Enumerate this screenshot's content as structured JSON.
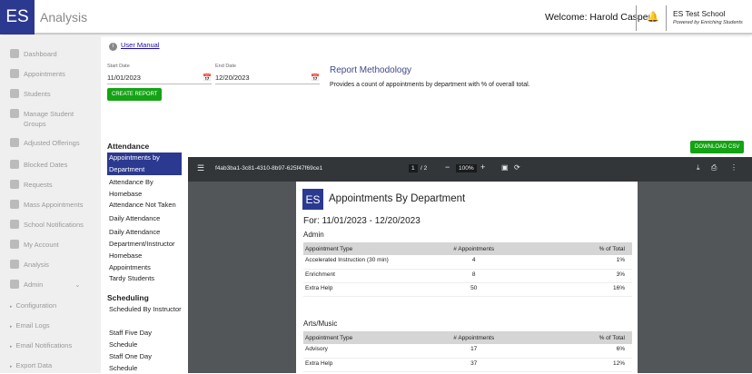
{
  "header": {
    "logo": "ES",
    "title": "Analysis",
    "welcome": "Welcome: Harold Casper",
    "school": "ES Test School",
    "powered": "Powered by Enriching Students"
  },
  "sidebar": {
    "items": [
      {
        "label": "Dashboard",
        "icon": "dashboard-icon"
      },
      {
        "label": "Appointments",
        "icon": "calendar-check-icon"
      },
      {
        "label": "Students",
        "icon": "graduation-cap-icon"
      },
      {
        "label": "Manage Student Groups",
        "icon": "group-icon"
      },
      {
        "label": "Adjusted Offerings",
        "icon": "laptop-icon"
      },
      {
        "label": "Blocked Dates",
        "icon": "calendar-x-icon"
      },
      {
        "label": "Requests",
        "icon": "request-icon"
      },
      {
        "label": "Mass Appointments",
        "icon": "calendar-icon"
      },
      {
        "label": "School Notifications",
        "icon": "bell-icon"
      },
      {
        "label": "My Account",
        "icon": "account-icon"
      },
      {
        "label": "Analysis",
        "icon": "pie-chart-icon"
      },
      {
        "label": "Admin",
        "icon": "gear-icon"
      }
    ],
    "subitems": [
      "Configuration",
      "Email Logs",
      "Email Notifications",
      "Export Data"
    ]
  },
  "form": {
    "user_manual": "User Manual",
    "start_label": "Start Date",
    "start_value": "11/01/2023",
    "end_label": "End Date",
    "end_value": "12/20/2023",
    "create": "CREATE REPORT",
    "method_title": "Report Methodology",
    "method_desc": "Provides a count of appointments by department with % of overall total.",
    "download": "DOWNLOAD CSV"
  },
  "reports": {
    "attendance_heading": "Attendance",
    "attendance": [
      "Appointments by Department",
      "Attendance By Homebase",
      "Attendance Not Taken",
      "Daily Attendance",
      "Daily Attendance Department/Instructor",
      "Homebase Appointments",
      "Tardy Students"
    ],
    "scheduling_heading": "Scheduling",
    "scheduling": [
      "Scheduled By Instructor",
      "Staff Five Day Schedule",
      "Staff One Day Schedule"
    ]
  },
  "viewer": {
    "filename": "f4ab3ba1-3c81-4310-8b97-625f47f69ce1",
    "page": "1",
    "pages": "/ 2",
    "zoom": "100%"
  },
  "doc": {
    "logo": "ES",
    "title": "Appointments By Department",
    "range": "For: 11/01/2023 - 12/20/2023",
    "cols": [
      "Appointment Type",
      "# Appointments",
      "% of Total"
    ],
    "sections": [
      {
        "name": "Admin",
        "rows": [
          [
            "Accelerated Instruction (30 min)",
            "4",
            "1%"
          ],
          [
            "Enrichment",
            "8",
            "3%"
          ],
          [
            "Extra Help",
            "50",
            "16%"
          ]
        ]
      },
      {
        "name": "Arts/Music",
        "rows": [
          [
            "Advisory",
            "17",
            "6%"
          ],
          [
            "Extra Help",
            "37",
            "12%"
          ]
        ]
      }
    ]
  }
}
